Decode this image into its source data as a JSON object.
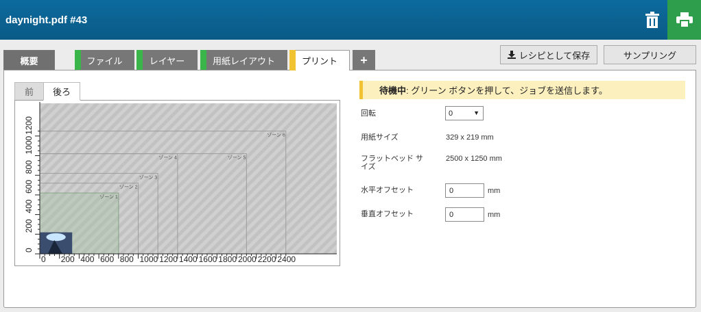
{
  "header": {
    "title": "daynight.pdf #43"
  },
  "tabs": [
    {
      "label": "概要"
    },
    {
      "label": "ファイル"
    },
    {
      "label": "レイヤー"
    },
    {
      "label": "用紙レイアウト"
    },
    {
      "label": "プリント"
    },
    {
      "label": "+"
    }
  ],
  "actions": {
    "save_recipe": "レシピとして保存",
    "sampling": "サンプリング"
  },
  "preview": {
    "front_tab": "前",
    "back_tab": "後ろ",
    "zones": [
      "ゾーン 1",
      "ゾーン 2",
      "ゾーン 3",
      "ゾーン 4",
      "ゾーン 5",
      "ゾーン 6"
    ]
  },
  "chart_data": {
    "type": "scatter",
    "x_ticks": [
      0,
      200,
      400,
      600,
      800,
      1000,
      1200,
      1400,
      1600,
      1800,
      2000,
      2200,
      2400
    ],
    "y_ticks": [
      0,
      200,
      400,
      600,
      800,
      1000,
      1200
    ],
    "xlim": [
      0,
      2500
    ],
    "ylim": [
      0,
      1250
    ],
    "paper": {
      "x": 0,
      "y": 0,
      "width": 329,
      "height": 219
    },
    "zones": [
      {
        "name": "ゾーン 1",
        "x_end": 800,
        "y_end": 620
      },
      {
        "name": "ゾーン 2",
        "x_end": 1000,
        "y_end": 720
      },
      {
        "name": "ゾーン 3",
        "x_end": 1200,
        "y_end": 820
      },
      {
        "name": "ゾーン 4",
        "x_end": 1400,
        "y_end": 1020
      },
      {
        "name": "ゾーン 5",
        "x_end": 2100,
        "y_end": 1020
      },
      {
        "name": "ゾーン 6",
        "x_end": 2500,
        "y_end": 1250
      }
    ]
  },
  "status": {
    "state": "待機中",
    "message": ": グリーン ボタンを押して、ジョブを送信します。"
  },
  "settings": {
    "rotation_label": "回転",
    "rotation_value": "0",
    "paper_size_label": "用紙サイズ",
    "paper_size_value": "329 x 219 mm",
    "flatbed_size_label": "フラットベッド サイズ",
    "flatbed_size_value": "2500 x 1250 mm",
    "h_offset_label": "水平オフセット",
    "h_offset_value": "0",
    "v_offset_label": "垂直オフセット",
    "v_offset_value": "0",
    "unit": "mm"
  },
  "colors": {
    "header": "#0a5f8c",
    "print_button": "#2f9e4c",
    "tab_accent_green": "#3ab54a",
    "tab_accent_yellow": "#f1c232"
  }
}
